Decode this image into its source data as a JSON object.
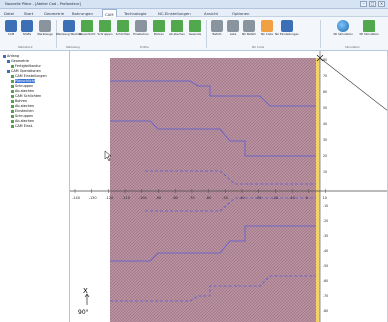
{
  "window": {
    "title": "Nouvelle Pièce - [Atelier Cad - Profondeur]"
  },
  "menu": {
    "items": [
      {
        "label": "Datei"
      },
      {
        "label": "Start"
      },
      {
        "label": "Geometrie"
      },
      {
        "label": "Bohrungen"
      },
      {
        "label": "CAM"
      },
      {
        "label": "Technologie"
      },
      {
        "label": "NC-Einstellungen"
      },
      {
        "label": "Ansicht"
      },
      {
        "label": "Optionen"
      }
    ],
    "active_index": 4
  },
  "ribbon": {
    "buttons": [
      {
        "label": "CAM",
        "icon": "cam-icon"
      },
      {
        "label": "Stoffe",
        "icon": "material-icon"
      },
      {
        "label": "Werkzeuge",
        "icon": "tools-icon"
      },
      {
        "label": "Werkzeug Wechsel",
        "icon": "tool-change-icon"
      },
      {
        "label": "Planschlicht",
        "icon": "facing-icon"
      },
      {
        "label": "Schruppen",
        "icon": "roughing-icon"
      },
      {
        "label": "Schlichten",
        "icon": "finishing-icon"
      },
      {
        "label": "Einstechen",
        "icon": "grooving-icon"
      },
      {
        "label": "Bohren",
        "icon": "drilling-icon"
      },
      {
        "label": "Ab-stechen",
        "icon": "parting-icon"
      },
      {
        "label": "Gewinde",
        "icon": "thread-icon"
      },
      {
        "label": "Befehl",
        "icon": "command-icon"
      },
      {
        "label": "Liste",
        "icon": "list-icon"
      },
      {
        "label": "NC Befehl",
        "icon": "nc-command-icon"
      },
      {
        "label": "NC Code",
        "icon": "nc-code-icon"
      },
      {
        "label": "NC Einstellungen",
        "icon": "nc-settings-icon"
      },
      {
        "label": "3D Simulation",
        "icon": "3d-simulation-icon"
      },
      {
        "label": "3D Simulation",
        "icon": "3d-simulation-2-icon"
      }
    ],
    "groups": [
      "Werkstück",
      "Werkzeug",
      "Profile",
      "NC Code",
      "Simulation"
    ]
  },
  "tree": {
    "items": [
      {
        "label": "Anfang"
      },
      {
        "label": "Geometrie"
      },
      {
        "label": "Fertigteilkontur"
      },
      {
        "label": "CAM Operationen"
      },
      {
        "label": "CAM Einstellungen"
      },
      {
        "label": "Planschlicht"
      },
      {
        "label": "Schruppen"
      },
      {
        "label": "Ab-stechen"
      },
      {
        "label": "CAM Schlichten"
      },
      {
        "label": "Bohren"
      },
      {
        "label": "Ab-stechen"
      },
      {
        "label": "Einstechen"
      },
      {
        "label": "Schruppen"
      },
      {
        "label": "Ab-stechen"
      },
      {
        "label": "CAM Einst."
      }
    ]
  },
  "axis": {
    "x_ticks": [
      "-140",
      "-130",
      "-120",
      "-110",
      "-100",
      "-90",
      "-80",
      "-70",
      "-60",
      "-50",
      "-40",
      "-30",
      "-20",
      "-10",
      "0",
      "10"
    ],
    "y_ticks_top": [
      "80",
      "70",
      "60",
      "50",
      "40",
      "30",
      "20",
      "10"
    ],
    "y_ticks_bottom": [
      "-10",
      "-20",
      "-30",
      "-40",
      "-50",
      "-60",
      "-70",
      "-80"
    ],
    "x_label": "X",
    "angle_label": "90°"
  },
  "colors": {
    "stock_fill": "#b48b9a",
    "contour": "#5a5ad6",
    "accent_bar": "#f1d36a",
    "axis": "#4a4a4a"
  }
}
